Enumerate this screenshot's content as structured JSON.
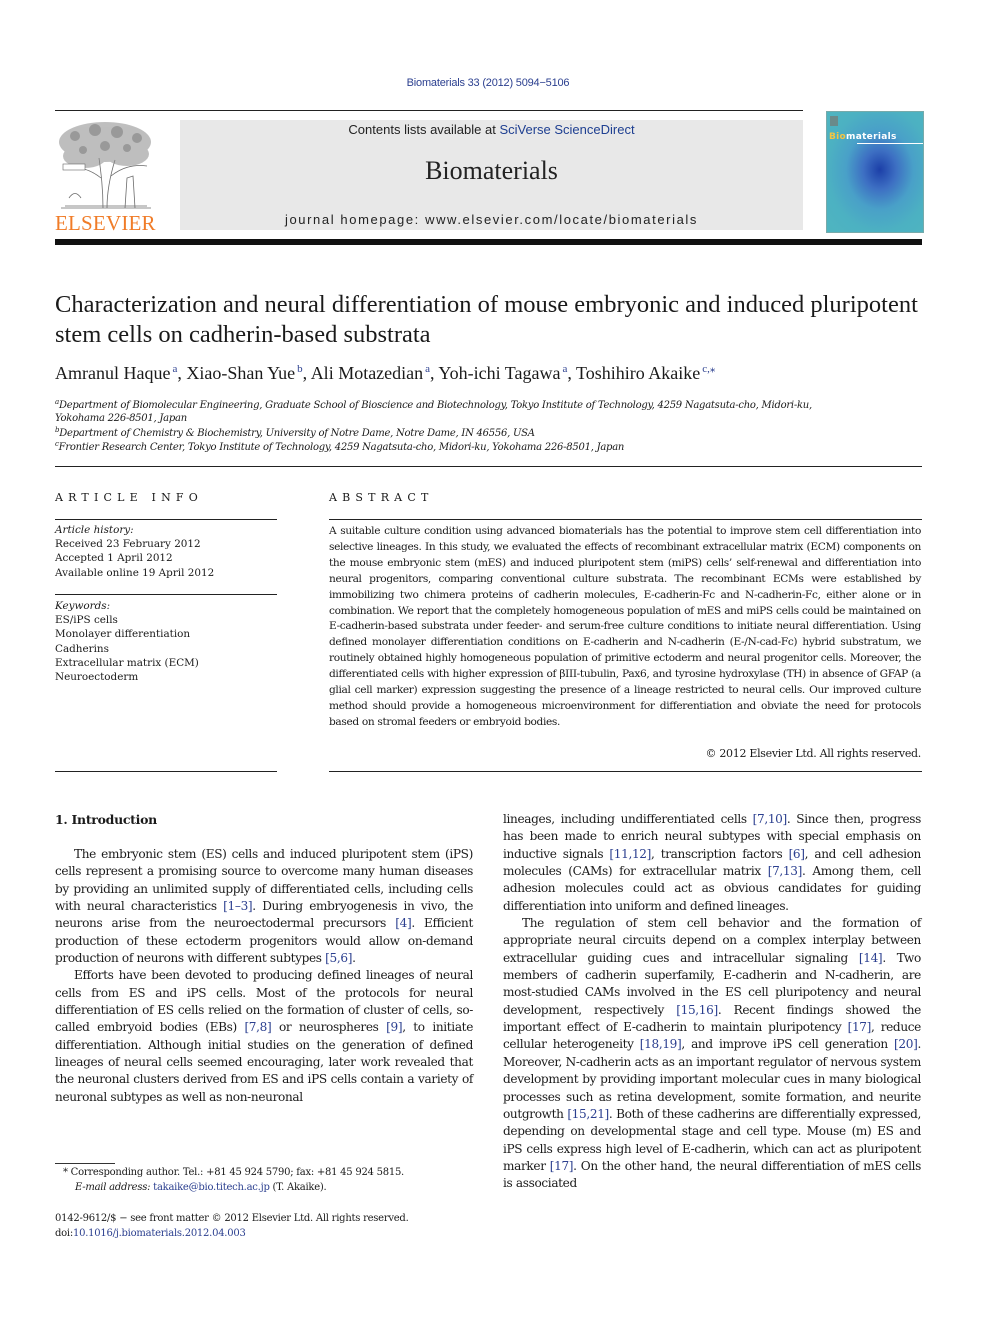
{
  "header": {
    "journal_reference": "Biomaterials 33 (2012) 5094−5106",
    "publisher_logo_text": "ELSEVIER",
    "contents_prefix": "Contents lists available at ",
    "contents_link": "SciVerse ScienceDirect",
    "journal_name": "Biomaterials",
    "homepage_text": "journal homepage: www.elsevier.com/locate/biomaterials",
    "cover_title_highlight": "Bio",
    "cover_title_rest": "materials",
    "colors": {
      "link": "#2b3f8f",
      "elsevier_orange": "#f07c28",
      "masthead_bg": "#e8e8e8",
      "cover_teal": "#4fb5c0"
    }
  },
  "article": {
    "title": "Characterization and neural differentiation of mouse embryonic and induced pluripotent stem cells on cadherin-based substrata",
    "authors": [
      {
        "name": "Amranul Haque",
        "affil": "a",
        "sep": ", "
      },
      {
        "name": "Xiao-Shan Yue",
        "affil": "b",
        "sep": ", "
      },
      {
        "name": "Ali Motazedian",
        "affil": "a",
        "sep": ", "
      },
      {
        "name": "Yoh-ichi Tagawa",
        "affil": "a",
        "sep": ", "
      },
      {
        "name": "Toshihiro Akaike",
        "affil": "c,⁎",
        "sep": ""
      }
    ],
    "affiliations": [
      {
        "key": "a",
        "text": "Department of Biomolecular Engineering, Graduate School of Bioscience and Biotechnology, Tokyo Institute of Technology, 4259 Nagatsuta-cho, Midori-ku,",
        "text2": "Yokohama 226-8501, Japan"
      },
      {
        "key": "b",
        "text": "Department of Chemistry & Biochemistry, University of Notre Dame, Notre Dame, IN 46556, USA"
      },
      {
        "key": "c",
        "text": "Frontier Research Center, Tokyo Institute of Technology, 4259 Nagatsuta-cho, Midori-ku, Yokohama 226-8501, Japan"
      }
    ]
  },
  "article_info": {
    "heading": "ARTICLE INFO",
    "history_label": "Article history:",
    "history": [
      "Received 23 February 2012",
      "Accepted 1 April 2012",
      "Available online 19 April 2012"
    ],
    "keywords_label": "Keywords:",
    "keywords": [
      "ES/iPS cells",
      "Monolayer differentiation",
      "Cadherins",
      "Extracellular matrix (ECM)",
      "Neuroectoderm"
    ]
  },
  "abstract": {
    "heading": "ABSTRACT",
    "text": "A suitable culture condition using advanced biomaterials has the potential to improve stem cell differentiation into selective lineages. In this study, we evaluated the effects of recombinant extracellular matrix (ECM) components on the mouse embryonic stem (mES) and induced pluripotent stem (miPS) cells’ self-renewal and differentiation into neural progenitors, comparing conventional culture substrata. The recombinant ECMs were established by immobilizing two chimera proteins of cadherin molecules, E-cadherin-Fc and N-cadherin-Fc, either alone or in combination. We report that the completely homogeneous population of mES and miPS cells could be maintained on E-cadherin-based substrata under feeder- and serum-free culture conditions to initiate neural differentiation. Using defined monolayer differentiation conditions on E-cadherin and N-cadherin (E-/N-cad-Fc) hybrid substratum, we routinely obtained highly homogeneous population of primitive ectoderm and neural progenitor cells. Moreover, the differentiated cells with higher expression of βIII-tubulin, Pax6, and tyrosine hydroxylase (TH) in absence of GFAP (a glial cell marker) expression suggesting the presence of a lineage restricted to neural cells. Our improved culture method should provide a homogeneous microenvironment for differentiation and obviate the need for protocols based on stromal feeders or embryoid bodies.",
    "copyright": "© 2012 Elsevier Ltd. All rights reserved."
  },
  "introduction": {
    "heading": "1.  Introduction",
    "left_paragraphs": [
      [
        {
          "t": "The embryonic stem (ES) cells and induced pluripotent stem (iPS) cells represent a promising source to overcome many human diseases by providing an unlimited supply of differentiated cells, including cells with neural characteristics "
        },
        {
          "r": "[1–3]"
        },
        {
          "t": ". During embryogenesis in vivo, the neurons arise from the neuroectodermal precursors "
        },
        {
          "r": "[4]"
        },
        {
          "t": ". Efficient production of these ectoderm progenitors would allow on-demand production of neurons with different subtypes "
        },
        {
          "r": "[5,6]"
        },
        {
          "t": "."
        }
      ],
      [
        {
          "t": "Efforts have been devoted to producing defined lineages of neural cells from ES and iPS cells. Most of the protocols for neural differentiation of ES cells relied on the formation of cluster of cells, so-called embryoid bodies (EBs) "
        },
        {
          "r": "[7,8]"
        },
        {
          "t": " or neurospheres "
        },
        {
          "r": "[9]"
        },
        {
          "t": ", to initiate differentiation. Although initial studies on the generation of defined lineages of neural cells seemed encouraging, later work revealed that the neuronal clusters derived from ES and iPS cells contain a variety of neuronal subtypes as well as non-neuronal"
        }
      ]
    ],
    "right_paragraphs": [
      [
        {
          "t": "lineages, including undifferentiated cells "
        },
        {
          "r": "[7,10]"
        },
        {
          "t": ". Since then, progress has been made to enrich neural subtypes with special emphasis on inductive signals "
        },
        {
          "r": "[11,12]"
        },
        {
          "t": ", transcription factors "
        },
        {
          "r": "[6]"
        },
        {
          "t": ", and cell adhesion molecules (CAMs) for extracellular matrix "
        },
        {
          "r": "[7,13]"
        },
        {
          "t": ". Among them, cell adhesion molecules could act as obvious candidates for guiding differentiation into uniform and defined lineages."
        }
      ],
      [
        {
          "t": "The regulation of stem cell behavior and the formation of appropriate neural circuits depend on a complex interplay between extracellular guiding cues and intracellular signaling "
        },
        {
          "r": "[14]"
        },
        {
          "t": ". Two members of cadherin superfamily, E-cadherin and N-cadherin, are most-studied CAMs involved in the ES cell pluripotency and neural development, respectively "
        },
        {
          "r": "[15,16]"
        },
        {
          "t": ". Recent findings showed the important effect of E-cadherin to maintain pluripotency "
        },
        {
          "r": "[17]"
        },
        {
          "t": ", reduce cellular heterogeneity "
        },
        {
          "r": "[18,19]"
        },
        {
          "t": ", and improve iPS cell generation "
        },
        {
          "r": "[20]"
        },
        {
          "t": ". Moreover, N-cadherin acts as an important regulator of nervous system development by providing important molecular cues in many biological processes such as retina development, somite formation, and neurite outgrowth "
        },
        {
          "r": "[15,21]"
        },
        {
          "t": ". Both of these cadherins are differentially expressed, depending on developmental stage and cell type. Mouse (m) ES and iPS cells express high level of E-cadherin, which can act as pluripotent marker "
        },
        {
          "r": "[17]"
        },
        {
          "t": ". On the other hand, the neural differentiation of mES cells is associated"
        }
      ]
    ]
  },
  "footnotes": {
    "corresponding_marker": "*",
    "corresponding_text": " Corresponding author. Tel.: +81 45 924 5790; fax: +81 45 924 5815.",
    "email_label": "E-mail address: ",
    "email": "takaike@bio.titech.ac.jp",
    "email_suffix": " (T. Akaike).",
    "front_matter": "0142-9612/$ − see front matter © 2012 Elsevier Ltd. All rights reserved.",
    "doi_prefix": "doi:",
    "doi": "10.1016/j.biomaterials.2012.04.003"
  }
}
